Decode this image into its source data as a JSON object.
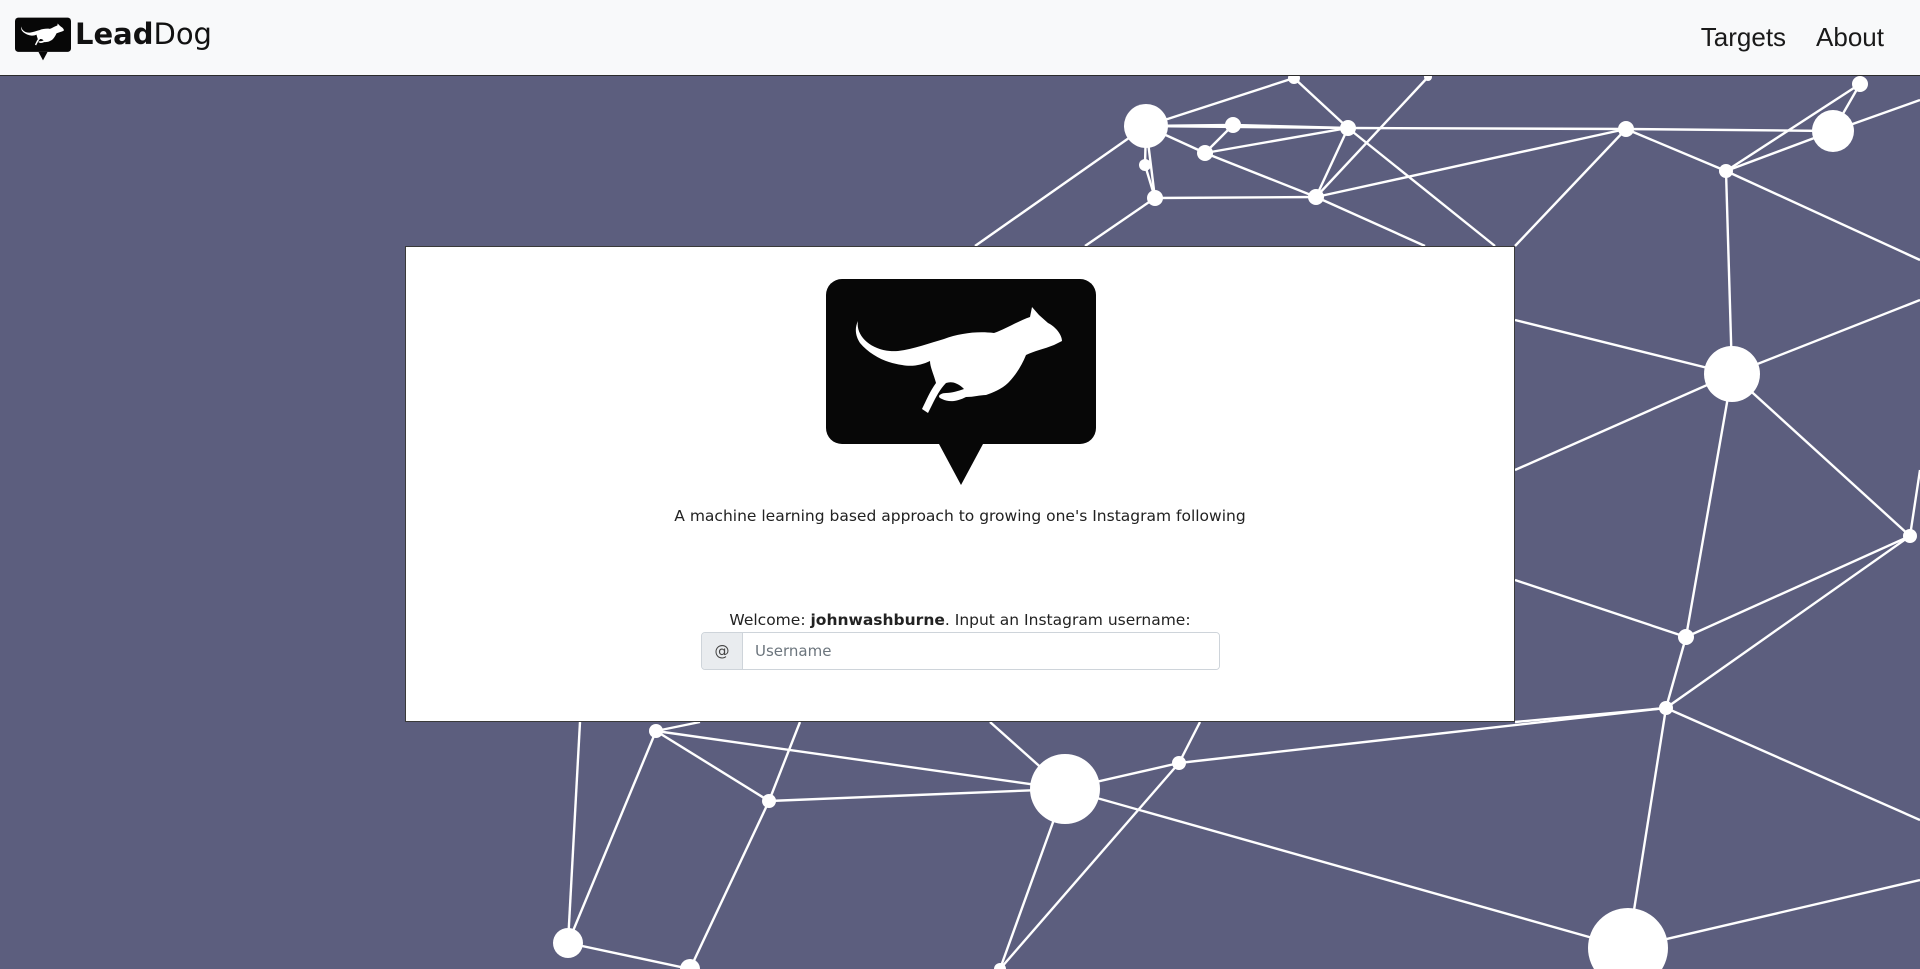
{
  "navbar": {
    "brand_bold": "Lead",
    "brand_regular": "Dog",
    "links": [
      {
        "label": "Targets"
      },
      {
        "label": "About"
      }
    ]
  },
  "card": {
    "tagline": "A machine learning based approach to growing one's Instagram following",
    "welcome_prefix": "Welcome: ",
    "welcome_user": "johnwashburne",
    "welcome_suffix": ". Input an Instagram username:",
    "at_symbol": "@",
    "username_placeholder": "Username",
    "username_value": ""
  },
  "icons": {
    "brand_logo": "running-dog-speech-bubble-icon",
    "hero_logo": "running-dog-speech-bubble-icon"
  },
  "colors": {
    "background": "#5c5e7e",
    "navbar": "#f8f9fa",
    "card": "#ffffff",
    "logo": "#070707",
    "network_lines": "#ffffff"
  }
}
